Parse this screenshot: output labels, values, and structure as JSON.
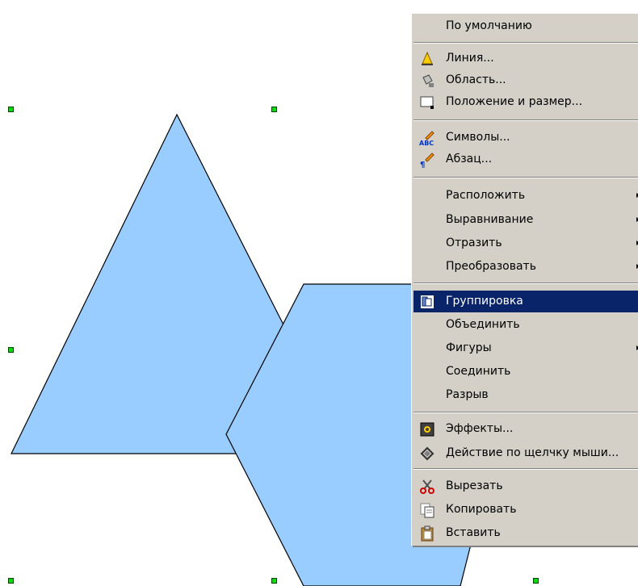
{
  "colors": {
    "shape_fill": "#99ccff",
    "shape_stroke": "#000000",
    "handle": "#00e000",
    "menu_bg": "#d4d0c8",
    "menu_highlight": "#0a246a"
  },
  "context_menu": {
    "default": "По умолчанию",
    "line": "Линия...",
    "area": "Область...",
    "position_size": "Положение и размер...",
    "characters": "Символы...",
    "paragraph": "Абзац...",
    "arrange": "Расположить",
    "alignment": "Выравнивание",
    "flip": "Отразить",
    "convert": "Преобразовать",
    "group": "Группировка",
    "combine": "Объединить",
    "shapes": "Фигуры",
    "connect": "Соединить",
    "break": "Разрыв",
    "effects": "Эффекты...",
    "interaction": "Действие по щелчку мыши...",
    "cut": "Вырезать",
    "copy": "Копировать",
    "paste": "Вставить",
    "highlighted_item": "Группировка"
  },
  "icons": {
    "line": "line-icon",
    "area": "area-bucket-icon",
    "position_size": "position-size-icon",
    "characters": "characters-icon",
    "paragraph": "paragraph-icon",
    "group": "group-icon",
    "effects": "effects-icon",
    "interaction": "interaction-icon",
    "cut": "scissors-icon",
    "copy": "copy-icon",
    "paste": "paste-icon"
  }
}
